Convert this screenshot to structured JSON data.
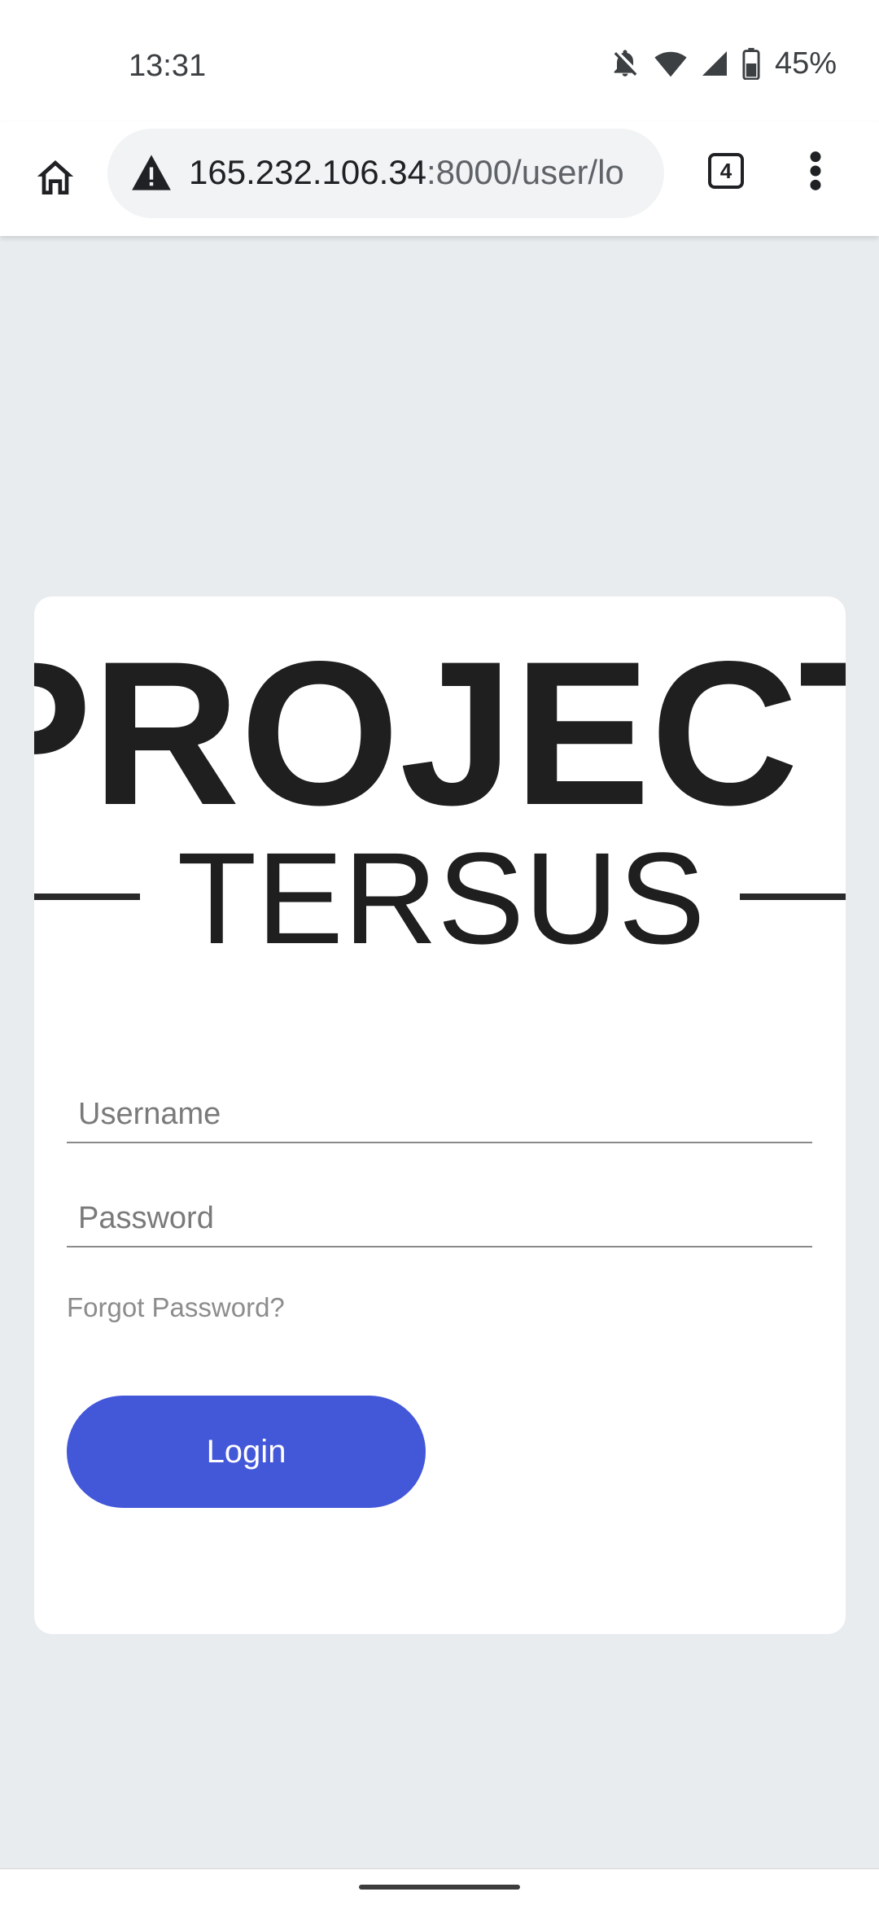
{
  "status_bar": {
    "time": "13:31",
    "battery": "45%",
    "icons": [
      "notifications-off-icon",
      "wifi-icon",
      "signal-icon",
      "battery-icon"
    ]
  },
  "browser": {
    "url_host": "165.232.106.34",
    "url_rest": ":8000/user/lo",
    "tab_count": "4",
    "icons": [
      "home-icon",
      "not-secure-warning-icon",
      "tabs-icon",
      "more-vert-icon"
    ]
  },
  "login": {
    "logo_line1": "PROJECT",
    "logo_line2": "TERSUS",
    "username_placeholder": "Username",
    "password_placeholder": "Password",
    "forgot_label": "Forgot Password?",
    "login_label": "Login"
  },
  "colors": {
    "page_background": "#e9ecee",
    "card_background": "#ffffff",
    "login_button": "#4357d9",
    "logo_text": "#1f1f1f"
  }
}
